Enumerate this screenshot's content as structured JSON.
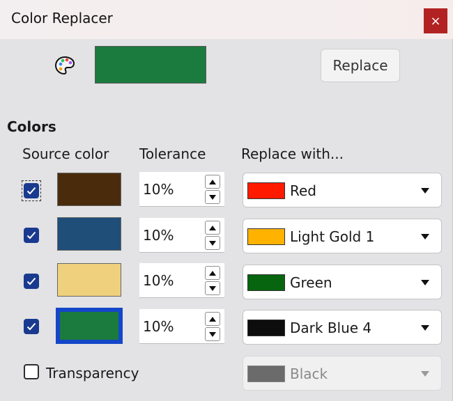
{
  "window": {
    "title": "Color Replacer",
    "close_symbol": "×"
  },
  "toolbar": {
    "palette_icon": "palette-icon",
    "preview_color": "#1b7a3d",
    "replace_label": "Replace"
  },
  "section": {
    "title": "Colors",
    "headers": {
      "source": "Source color",
      "tolerance": "Tolerance",
      "replace_with": "Replace with..."
    }
  },
  "rows": [
    {
      "checked": true,
      "source_color": "#4a2c0c",
      "tolerance": "10%",
      "replace_color": "#ff1a00",
      "replace_label": "Red"
    },
    {
      "checked": true,
      "source_color": "#1f4e79",
      "tolerance": "10%",
      "replace_color": "#ffb300",
      "replace_label": "Light Gold 1"
    },
    {
      "checked": true,
      "source_color": "#efd07d",
      "tolerance": "10%",
      "replace_color": "#06650e",
      "replace_label": "Green"
    },
    {
      "checked": true,
      "source_color": "#1b7a3d",
      "tolerance": "10%",
      "replace_color": "#0d0d0d",
      "replace_label": "Dark Blue 4",
      "selected": true
    }
  ],
  "transparency": {
    "label": "Transparency",
    "checked": false,
    "replace_color": "#6b6b6b",
    "replace_label": "Black",
    "disabled": true
  },
  "colors": {
    "checkbox_accent": "#193a8f",
    "selection_border": "#1446c8",
    "close_bg": "#b32222"
  }
}
